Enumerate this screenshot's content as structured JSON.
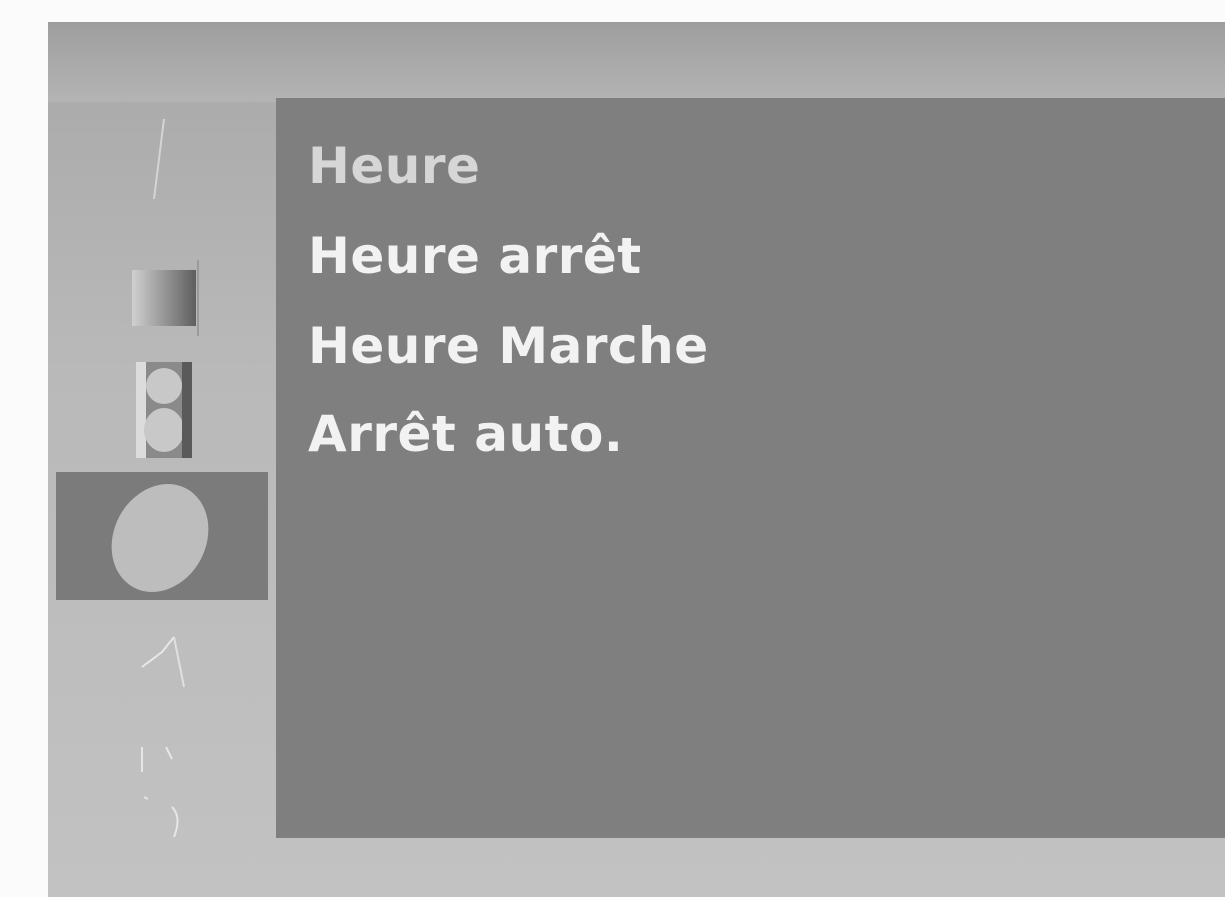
{
  "sidebar": {
    "icons": [
      {
        "name": "picture-icon",
        "selected": false
      },
      {
        "name": "screen-icon",
        "selected": false
      },
      {
        "name": "audio-icon",
        "selected": false
      },
      {
        "name": "time-icon",
        "selected": true
      },
      {
        "name": "option-icon",
        "selected": false
      },
      {
        "name": "lock-icon",
        "selected": false
      }
    ]
  },
  "menu": {
    "items": [
      {
        "label": "Heure"
      },
      {
        "label": "Heure arrêt"
      },
      {
        "label": "Heure Marche"
      },
      {
        "label": "Arrêt auto."
      }
    ]
  },
  "colors": {
    "panel": "#7f7f7f",
    "selected_tab": "#7b7b7b",
    "frame": "#b9b9b9",
    "text": "#f2f2f2"
  }
}
